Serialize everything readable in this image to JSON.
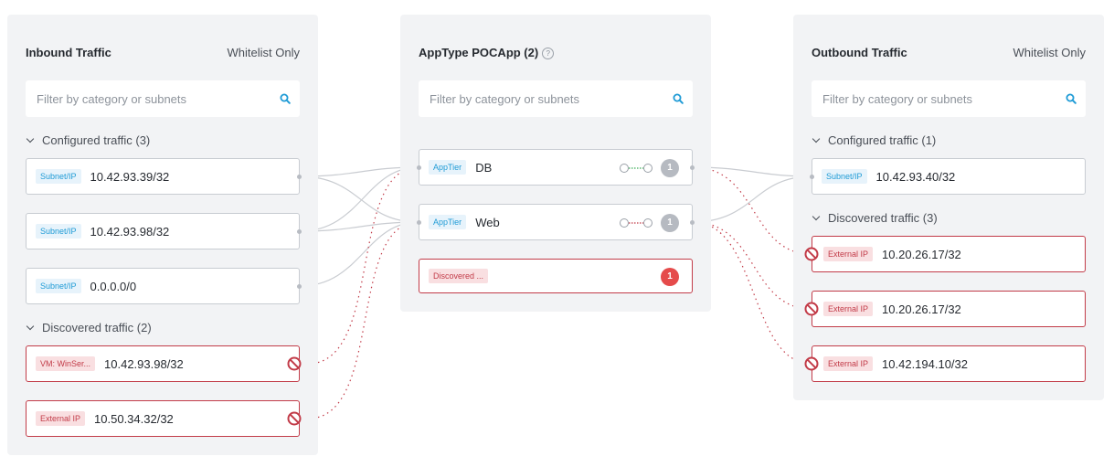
{
  "inbound": {
    "title": "Inbound Traffic",
    "mode": "Whitelist Only",
    "search_placeholder": "Filter by category or subnets",
    "configured_label": "Configured traffic (3)",
    "configured": [
      {
        "tag": "Subnet/IP",
        "value": "10.42.93.39/32"
      },
      {
        "tag": "Subnet/IP",
        "value": "10.42.93.98/32"
      },
      {
        "tag": "Subnet/IP",
        "value": "0.0.0.0/0"
      }
    ],
    "discovered_label": "Discovered traffic (2)",
    "discovered": [
      {
        "tag": "VM: WinSer...",
        "value": "10.42.93.98/32"
      },
      {
        "tag": "External IP",
        "value": "10.50.34.32/32"
      }
    ]
  },
  "app": {
    "title": "AppType POCApp (2)",
    "help": "?",
    "search_placeholder": "Filter by category or subnets",
    "tiers": [
      {
        "tag": "AppTier",
        "name": "DB",
        "count": "1"
      },
      {
        "tag": "AppTier",
        "name": "Web",
        "count": "1"
      }
    ],
    "discovered": {
      "tag": "Discovered ...",
      "count": "1"
    }
  },
  "outbound": {
    "title": "Outbound Traffic",
    "mode": "Whitelist Only",
    "search_placeholder": "Filter by category or subnets",
    "configured_label": "Configured traffic (1)",
    "configured": [
      {
        "tag": "Subnet/IP",
        "value": "10.42.93.40/32"
      }
    ],
    "discovered_label": "Discovered traffic (3)",
    "discovered": [
      {
        "tag": "External IP",
        "value": "10.20.26.17/32"
      },
      {
        "tag": "External IP",
        "value": "10.20.26.17/32"
      },
      {
        "tag": "External IP",
        "value": "10.42.194.10/32"
      }
    ]
  },
  "colors": {
    "accent": "#1f9bd6",
    "danger": "#c23b48",
    "allowed": "#3fae5a",
    "panel": "#f2f3f5"
  },
  "icons": {
    "search": "search-icon",
    "block": "blocked-icon",
    "chevron": "chevron-down-icon",
    "help": "help-icon"
  }
}
